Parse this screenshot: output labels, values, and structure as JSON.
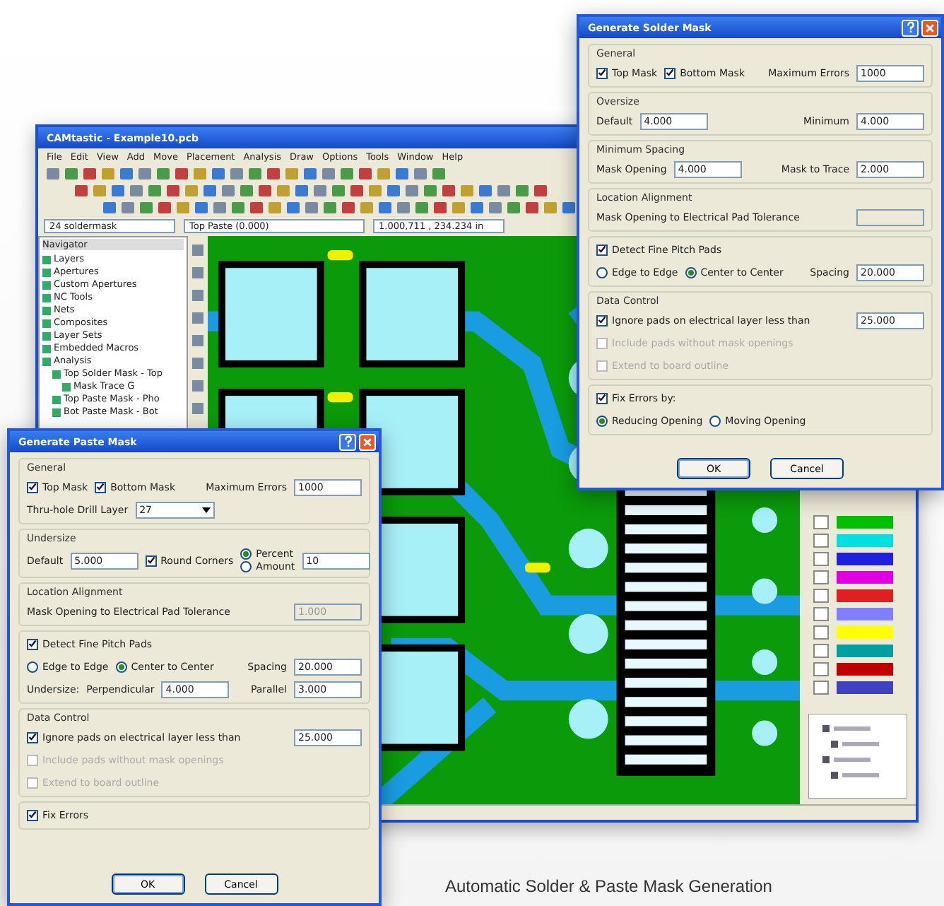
{
  "main_window": {
    "title": "CAMtastic - Example10.pcb",
    "menu": [
      "File",
      "Edit",
      "View",
      "Add",
      "Move",
      "Placement",
      "Analysis",
      "Draw",
      "Options",
      "Tools",
      "Window",
      "Help"
    ],
    "layer_select": "24 soldermask",
    "aperture_select": "Top Paste (0.000)",
    "coordinates": "1.000,711 , 234.234 in",
    "tree_header": "Navigator",
    "tree": [
      {
        "label": "Layers"
      },
      {
        "label": "Apertures"
      },
      {
        "label": "Custom Apertures"
      },
      {
        "label": "NC Tools"
      },
      {
        "label": "Nets"
      },
      {
        "label": "Composites"
      },
      {
        "label": "Layer Sets"
      },
      {
        "label": "Embedded Macros"
      },
      {
        "label": "Analysis",
        "children": [
          {
            "label": "Top Solder Mask - Top",
            "children": [
              {
                "label": "Mask Trace G"
              }
            ]
          },
          {
            "label": "Top Paste Mask - Pho"
          },
          {
            "label": "Bot Paste Mask - Bot"
          }
        ]
      }
    ]
  },
  "solder_dialog": {
    "title": "Generate Solder Mask",
    "groups": [
      {
        "title": "General",
        "rows": [
          [
            {
              "kind": "check",
              "label": "Top Mask",
              "checked": true
            },
            {
              "kind": "check",
              "label": "Bottom Mask",
              "checked": true
            },
            {
              "kind": "label",
              "text": "Maximum Errors"
            },
            {
              "kind": "field",
              "value": "1000"
            }
          ]
        ]
      },
      {
        "title": "Oversize",
        "rows": [
          [
            {
              "kind": "label",
              "text": "Default"
            },
            {
              "kind": "field",
              "value": "4.000"
            },
            {
              "kind": "label",
              "text": "Minimum"
            },
            {
              "kind": "field",
              "value": "4.000"
            }
          ]
        ]
      },
      {
        "title": "Minimum Spacing",
        "rows": [
          [
            {
              "kind": "label",
              "text": "Mask Opening"
            },
            {
              "kind": "field",
              "value": "4.000"
            },
            {
              "kind": "label",
              "text": "Mask to Trace"
            },
            {
              "kind": "field",
              "value": "2.000"
            }
          ]
        ]
      },
      {
        "title": "Location Alignment",
        "rows": [
          [
            {
              "kind": "label",
              "text": "Mask Opening to Electrical Pad Tolerance"
            },
            {
              "kind": "field",
              "disabled": true
            }
          ]
        ]
      },
      {
        "rows": [
          [
            {
              "kind": "check",
              "label": "Detect Fine Pitch Pads",
              "checked": true
            }
          ],
          [
            {
              "kind": "radio",
              "label": "Edge to Edge",
              "selected": false
            },
            {
              "kind": "radio",
              "label": "Center to Center",
              "selected": true
            },
            {
              "kind": "label",
              "text": "Spacing"
            },
            {
              "kind": "field",
              "value": "20.000"
            }
          ]
        ]
      },
      {
        "title": "Data Control",
        "rows": [
          [
            {
              "kind": "check",
              "label": "Ignore pads on electrical layer less than",
              "checked": true
            },
            {
              "kind": "field",
              "value": "25.000"
            }
          ],
          [
            {
              "kind": "check",
              "label": "Include pads without mask openings",
              "checked": false,
              "disabled": true
            }
          ],
          [
            {
              "kind": "check",
              "label": "Extend to board outline",
              "checked": false,
              "disabled": true
            }
          ]
        ]
      },
      {
        "rows": [
          [
            {
              "kind": "check",
              "label": "Fix Errors by:",
              "checked": true
            }
          ],
          [
            {
              "kind": "radio",
              "label": "Reducing Opening",
              "selected": true
            },
            {
              "kind": "radio",
              "label": "Moving Opening",
              "selected": false
            }
          ]
        ]
      }
    ],
    "buttons": [
      "OK",
      "Cancel"
    ]
  },
  "paste_dialog": {
    "title": "Generate Paste Mask",
    "groups": [
      {
        "title": "General",
        "rows": [
          [
            {
              "kind": "check",
              "label": "Top Mask",
              "checked": true
            },
            {
              "kind": "check",
              "label": "Bottom Mask",
              "checked": true
            },
            {
              "kind": "label",
              "text": "Maximum Errors"
            },
            {
              "kind": "field",
              "value": "1000"
            }
          ],
          [
            {
              "kind": "label",
              "text": "Thru-hole Drill Layer"
            },
            {
              "kind": "select",
              "value": "27"
            }
          ]
        ]
      },
      {
        "title": "Undersize",
        "rows": [
          [
            {
              "kind": "label",
              "text": "Default"
            },
            {
              "kind": "field",
              "value": "5.000"
            },
            {
              "kind": "check",
              "label": "Round Corners",
              "checked": true
            },
            {
              "kind": "radios",
              "options": [
                {
                  "label": "Percent",
                  "selected": true
                },
                {
                  "label": "Amount",
                  "selected": false
                }
              ]
            },
            {
              "kind": "field",
              "value": "10"
            }
          ]
        ]
      },
      {
        "title": "Location Alignment",
        "rows": [
          [
            {
              "kind": "label",
              "text": "Mask Opening to Electrical Pad Tolerance"
            },
            {
              "kind": "field",
              "value": "1.000",
              "disabled": true
            }
          ]
        ]
      },
      {
        "rows": [
          [
            {
              "kind": "check",
              "label": "Detect Fine Pitch Pads",
              "checked": true
            }
          ],
          [
            {
              "kind": "radio",
              "label": "Edge to Edge",
              "selected": false
            },
            {
              "kind": "radio",
              "label": "Center to Center",
              "selected": true
            },
            {
              "kind": "gap"
            },
            {
              "kind": "label",
              "text": "Spacing"
            },
            {
              "kind": "field",
              "value": "20.000"
            }
          ],
          [
            {
              "kind": "label",
              "text": "Undersize:"
            },
            {
              "kind": "label",
              "text": "Perpendicular"
            },
            {
              "kind": "field",
              "value": "4.000"
            },
            {
              "kind": "label",
              "text": "Parallel"
            },
            {
              "kind": "field",
              "value": "3.000"
            }
          ]
        ]
      },
      {
        "title": "Data Control",
        "rows": [
          [
            {
              "kind": "check",
              "label": "Ignore pads on electrical layer less than",
              "checked": true
            },
            {
              "kind": "field",
              "value": "25.000"
            }
          ],
          [
            {
              "kind": "check",
              "label": "Include pads without mask openings",
              "checked": false,
              "disabled": true
            }
          ],
          [
            {
              "kind": "check",
              "label": "Extend to board outline",
              "checked": false,
              "disabled": true
            }
          ]
        ]
      },
      {
        "rows": [
          [
            {
              "kind": "check",
              "label": "Fix Errors",
              "checked": true
            }
          ]
        ]
      }
    ],
    "buttons": [
      "OK",
      "Cancel"
    ]
  },
  "caption": "Automatic Solder & Paste Mask Generation"
}
